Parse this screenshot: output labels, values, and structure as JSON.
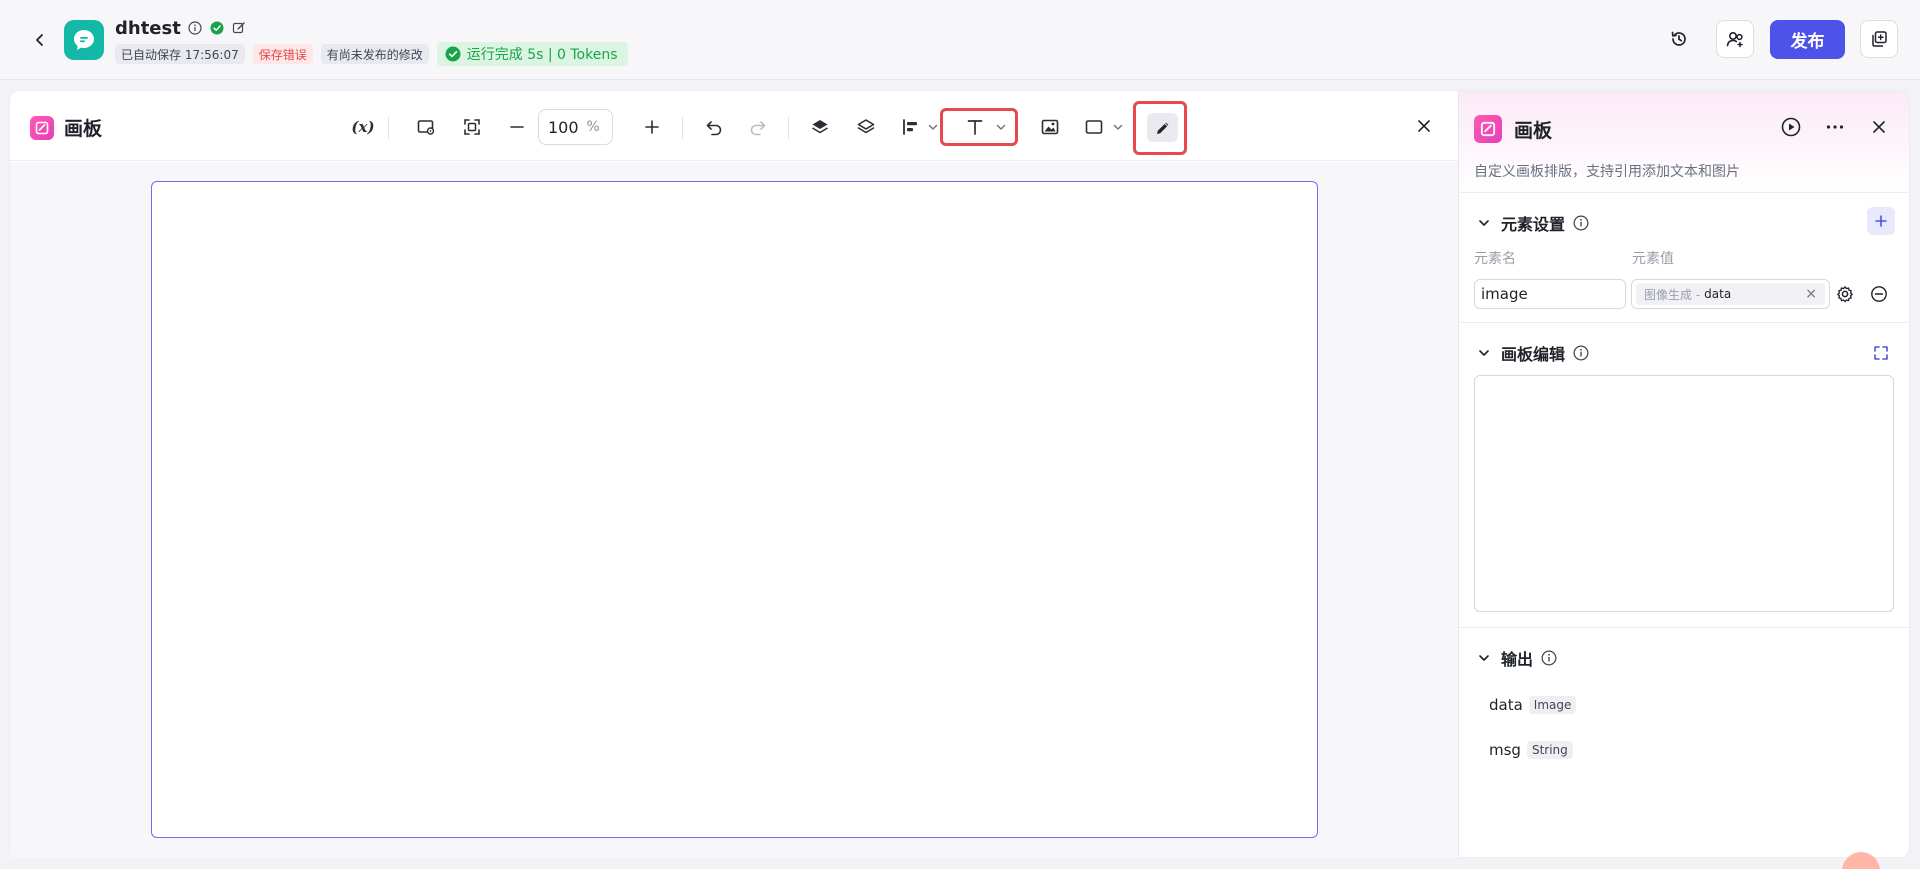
{
  "header": {
    "app_name": "dhtest",
    "autosave": "已自动保存 17:56:07",
    "save_error": "保存错误",
    "unpublished": "有尚未发布的修改",
    "run_status": "运行完成 5s | 0 Tokens",
    "publish_label": "发布"
  },
  "editor": {
    "title": "画板",
    "variable_label": "(x)",
    "zoom_value": "100",
    "zoom_unit": "%"
  },
  "panel": {
    "title": "画板",
    "description": "自定义画板排版，支持引用添加文本和图片",
    "element_settings": {
      "title": "元素设置",
      "col_name": "元素名",
      "col_value": "元素值",
      "rows": [
        {
          "name": "image",
          "ref_source": "图像生成 -",
          "ref_field": "data"
        }
      ]
    },
    "canvas_edit": {
      "title": "画板编辑"
    },
    "output": {
      "title": "输出",
      "items": [
        {
          "name": "data",
          "type": "Image"
        },
        {
          "name": "msg",
          "type": "String"
        }
      ]
    }
  },
  "colors": {
    "accent": "#4d53e8",
    "app_logo": "#14b8a6",
    "highlight": "#e5484d",
    "success": "#1aa34a",
    "canvas_border": "#6b6ff2"
  }
}
